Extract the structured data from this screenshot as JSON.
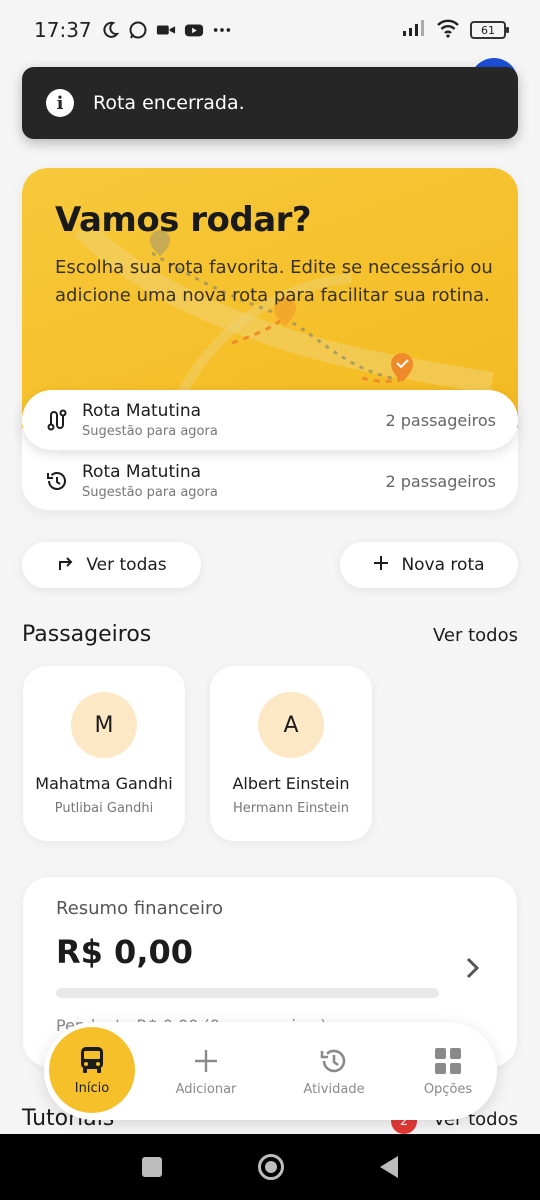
{
  "status_bar": {
    "time": "17:37",
    "battery": "61",
    "icons": [
      "moon-icon",
      "whatsapp-icon",
      "video-icon",
      "youtube-icon",
      "more-icon",
      "signal-icon",
      "wifi-icon",
      "battery-icon"
    ]
  },
  "toast": {
    "message": "Rota encerrada.",
    "icon": "info-icon"
  },
  "hero": {
    "title": "Vamos rodar?",
    "text": "Escolha sua rota favorita. Edite se necessário ou adicione uma nova rota para facilitar sua rotina.",
    "routes": [
      {
        "name": "Rota Matutina",
        "subtitle": "Sugestão para agora",
        "count": "2 passageiros",
        "icon": "route-icon"
      },
      {
        "name": "Rota Matutina",
        "subtitle": "Sugestão para agora",
        "count": "2 passageiros",
        "icon": "history-icon"
      }
    ]
  },
  "actions": {
    "view_all": "Ver todas",
    "new_route": "Nova rota"
  },
  "passengers": {
    "title": "Passageiros",
    "link": "Ver todos",
    "items": [
      {
        "initial": "M",
        "name": "Mahatma Gandhi",
        "guardian": "Putlibai Gandhi"
      },
      {
        "initial": "A",
        "name": "Albert Einstein",
        "guardian": "Hermann Einstein"
      }
    ]
  },
  "finance": {
    "title": "Resumo financeiro",
    "value": "R$ 0,00",
    "progress": 0,
    "subtitle": "Pendente R$ 0,00 (0 passageiros)"
  },
  "tutorials": {
    "title": "Tutoriais",
    "badge": "2",
    "link": "Ver todos"
  },
  "bottom_nav": {
    "home": "Início",
    "add": "Adicionar",
    "activity": "Atividade",
    "options": "Opções"
  },
  "colors": {
    "accent": "#f5c02a",
    "toast_bg": "#262626",
    "badge": "#e53935",
    "avatar_bg": "#fde8c6"
  }
}
